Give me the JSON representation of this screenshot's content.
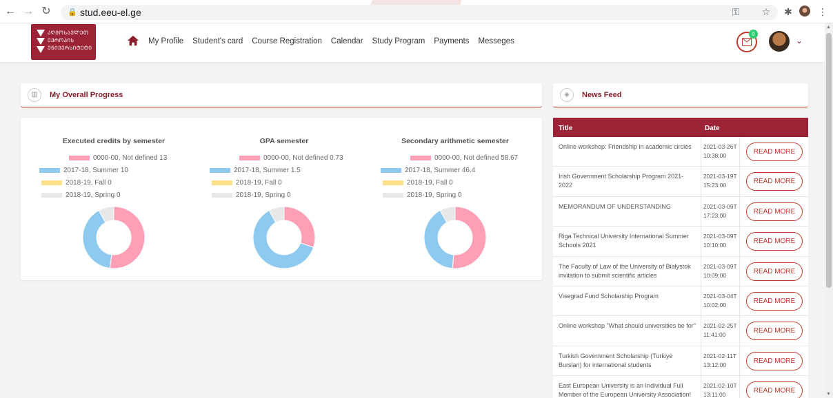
{
  "browser": {
    "url": "stud.eeu-el.ge"
  },
  "header": {
    "logo_lines": [
      "ᲐᲦᲛᲝᲡᲐᲕᲚᲔᲗ",
      "ᲔᲕᲠᲝᲞᲘᲡ",
      "ᲣᲜᲘᲕᲔᲠᲡᲘᲢᲔᲢᲘ"
    ],
    "menu": [
      "My Profile",
      "Student's card",
      "Course Registration",
      "Calendar",
      "Study Program",
      "Payments",
      "Messeges"
    ],
    "mail_badge": "0"
  },
  "progress": {
    "title": "My Overall Progress"
  },
  "news": {
    "title": "News Feed",
    "col_title": "Title",
    "col_date": "Date",
    "button_label": "READ MORE",
    "items": [
      {
        "title": "Online workshop: Friendship in academic circles",
        "date": "2021-03-26T10:38:00"
      },
      {
        "title": "Irish Government Scholarship Program 2021-2022",
        "date": "2021-03-19T15:23:00"
      },
      {
        "title": "MEMORANDUM OF UNDERSTANDING",
        "date": "2021-03-09T17:23:00"
      },
      {
        "title": "Riga Technical University International Summer Schools 2021",
        "date": "2021-03-09T10:10:00"
      },
      {
        "title": "The Faculty of Law of the University of Białystok invitation to submit scientific articles",
        "date": "2021-03-09T10:09:00"
      },
      {
        "title": "Visegrad Fund Scholarship Program",
        "date": "2021-03-04T10:02:00"
      },
      {
        "title": "Online workshop \"What should universities be for\"",
        "date": "2021-02-25T11:41:00"
      },
      {
        "title": "Turkish Government Scholarship (Turkiye Burslari) for international students",
        "date": "2021-02-11T13:12:00"
      },
      {
        "title": "East European University is an Individual Full Member of the European University Association!",
        "date": "2021-02-10T13:11:00"
      }
    ]
  },
  "colors": {
    "brand": "#9b2335",
    "pink": "#ff9fb5",
    "blue": "#8ec9f0",
    "yellow": "#ffe08a",
    "gray": "#e8e8e8"
  },
  "chart_data": [
    {
      "type": "pie",
      "title": "Executed credits by semester",
      "categories": [
        "0000-00, Not defined",
        "2017-18, Summer",
        "2018-19, Fall",
        "2018-19, Spring"
      ],
      "values": [
        13,
        10,
        0,
        0
      ],
      "legend": "top"
    },
    {
      "type": "pie",
      "title": "GPA semester",
      "categories": [
        "0000-00, Not defined",
        "2017-18, Summer",
        "2018-19, Fall",
        "2018-19, Spring"
      ],
      "values": [
        0.73,
        1.5,
        0,
        0
      ],
      "legend": "top"
    },
    {
      "type": "pie",
      "title": "Secondary arithmetic semester",
      "categories": [
        "0000-00, Not defined",
        "2017-18, Summer",
        "2018-19, Fall",
        "2018-19, Spring"
      ],
      "values": [
        58.67,
        46.4,
        0,
        0
      ],
      "legend": "top"
    }
  ]
}
